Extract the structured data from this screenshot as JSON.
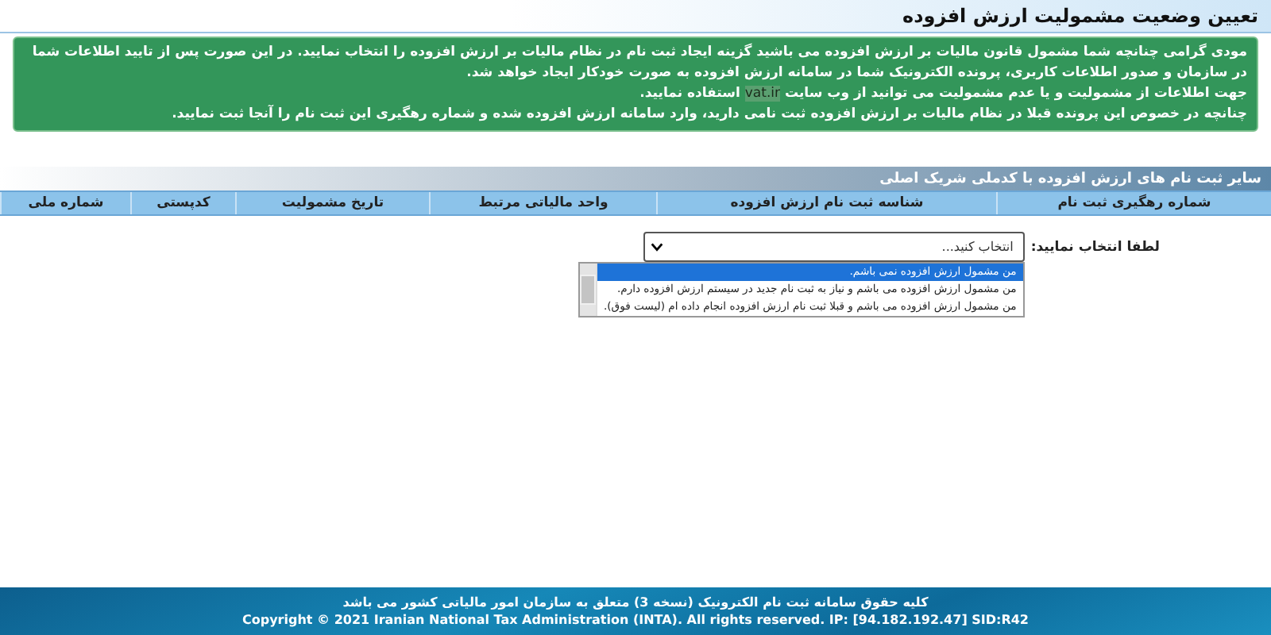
{
  "page": {
    "title": "تعیین وضعیت مشمولیت ارزش افزوده"
  },
  "notice": {
    "paragraphs": [
      {
        "parts": [
          {
            "kind": "text",
            "text": "مودی گرامی چنانچه شما مشمول قانون مالیات بر ارزش افزوده می باشید گزینه ایجاد ثبت نام در نظام مالیات بر ارزش افزوده را انتخاب نمایید. در این صورت پس از تایید اطلاعات شما در سازمان و صدور اطلاعات کاربری، پرونده الکترونیک شما در سامانه ارزش افزوده به صورت خودکار ایجاد خواهد شد."
          }
        ]
      },
      {
        "parts": [
          {
            "kind": "text",
            "text": "جهت اطلاعات از مشمولیت و یا عدم مشمولیت می توانید از وب سایت "
          },
          {
            "kind": "link",
            "text": "vat.ir"
          },
          {
            "kind": "text",
            "text": " استفاده نمایید."
          }
        ]
      },
      {
        "parts": [
          {
            "kind": "text",
            "text": "چنانچه در خصوص این پرونده قبلا در نظام مالیات بر ارزش افزوده ثبت نامی دارید، وارد سامانه ارزش افزوده شده و شماره رهگیری این ثبت نام را آنجا ثبت نمایید."
          }
        ]
      }
    ]
  },
  "section": {
    "title": "سایر ثبت نام های ارزش افزوده با کدملی شریک اصلی"
  },
  "table": {
    "columns": [
      "شماره رهگیری ثبت نام",
      "شناسه ثبت نام ارزش افزوده",
      "واحد مالیاتی مرتبط",
      "تاریخ مشمولیت",
      "کدپستی",
      "شماره ملی"
    ]
  },
  "selector": {
    "label": "لطفا انتخاب نمایید:",
    "value": "انتخاب کنید...",
    "expanded": true,
    "options": [
      {
        "label": "من مشمول ارزش افزوده نمی باشم.",
        "selected": true
      },
      {
        "label": "من مشمول ارزش افزوده می باشم و نیاز به ثبت نام جدید در سیستم ارزش افزوده دارم.",
        "selected": false
      },
      {
        "label": "من مشمول ارزش افزوده می باشم و قبلا ثبت نام ارزش افزوده انجام داده ام (لیست فوق).",
        "selected": false
      }
    ]
  },
  "footer": {
    "lines": [
      "کلیه حقوق سامانه ثبت نام الکترونیک (نسخه 3) متعلق به سازمان امور مالیاتی کشور می باشد",
      "Copyright © 2021 Iranian National Tax Administration (INTA). All rights reserved. IP: [94.182.192.47] SID:R42"
    ]
  }
}
